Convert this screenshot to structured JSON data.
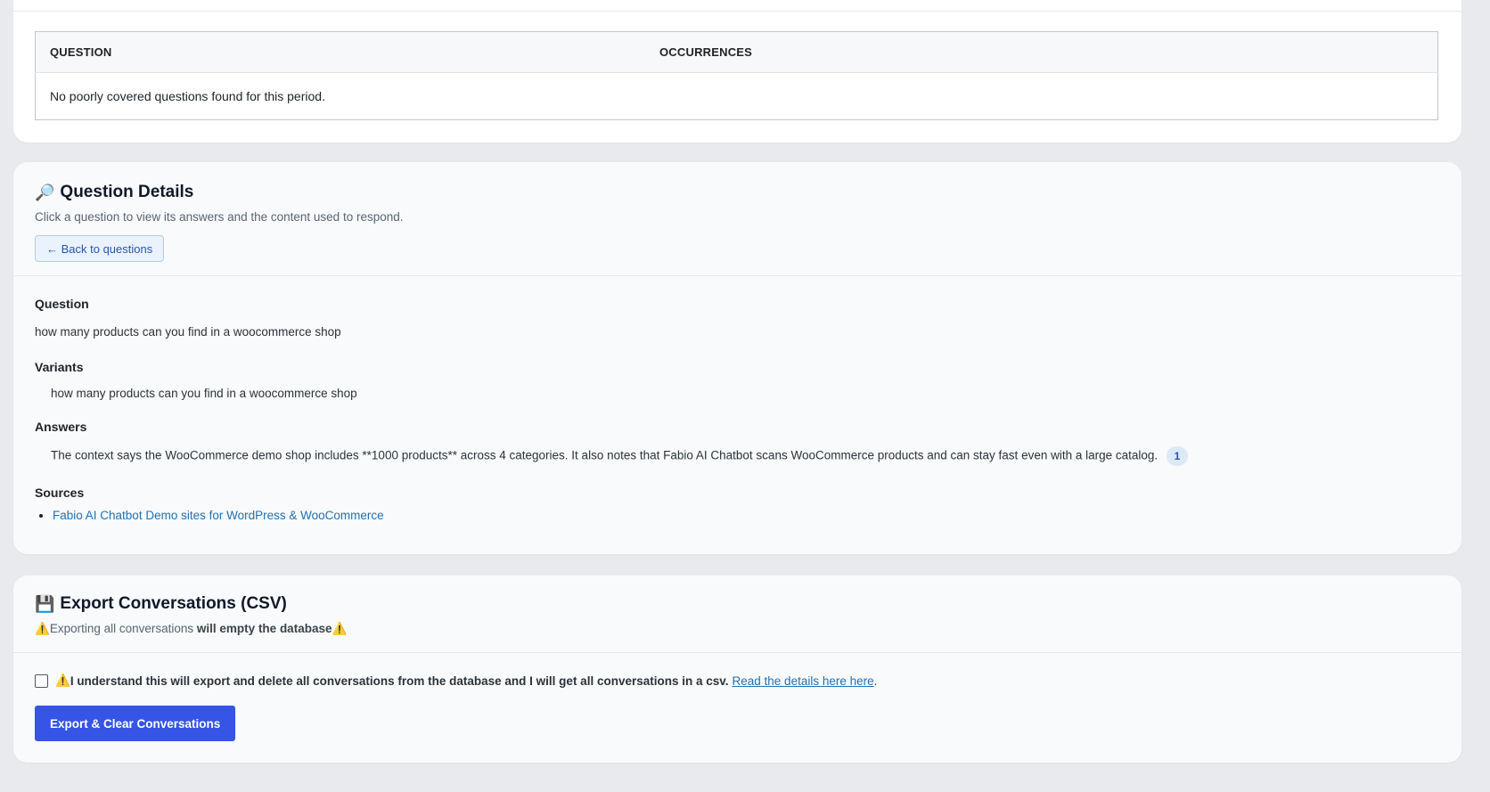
{
  "poor_coverage_table": {
    "columns": [
      "QUESTION",
      "OCCURRENCES"
    ],
    "empty_message": "No poorly covered questions found for this period."
  },
  "question_details": {
    "title_icon": "🔎",
    "title": "Question Details",
    "subtitle": "Click a question to view its answers and the content used to respond.",
    "back_button": "← Back to questions",
    "question_label": "Question",
    "question_text": "how many products can you find in a woocommerce shop",
    "variants_label": "Variants",
    "variants": [
      "how many products can you find in a woocommerce shop"
    ],
    "answers_label": "Answers",
    "answers": [
      {
        "text": "The context says the WooCommerce demo shop includes **1000 products** across 4 categories. It also notes that Fabio AI Chatbot scans WooCommerce products and can stay fast even with a large catalog.",
        "count": "1"
      }
    ],
    "sources_label": "Sources",
    "sources": [
      "Fabio AI Chatbot Demo sites for WordPress & WooCommerce"
    ]
  },
  "export": {
    "title_icon": "💾",
    "title": "Export Conversations (CSV)",
    "warning_icon": "⚠️",
    "warning_prefix": "Exporting all conversations",
    "warning_bold": "will empty the database",
    "confirm_text": "I understand this will export and delete all conversations from the database and I will get all conversations in a csv.",
    "confirm_link": "Read the details here here",
    "confirm_suffix": ".",
    "checkbox_checked": false,
    "button_label": "Export & Clear Conversations",
    "button_color": "#3654e6"
  }
}
